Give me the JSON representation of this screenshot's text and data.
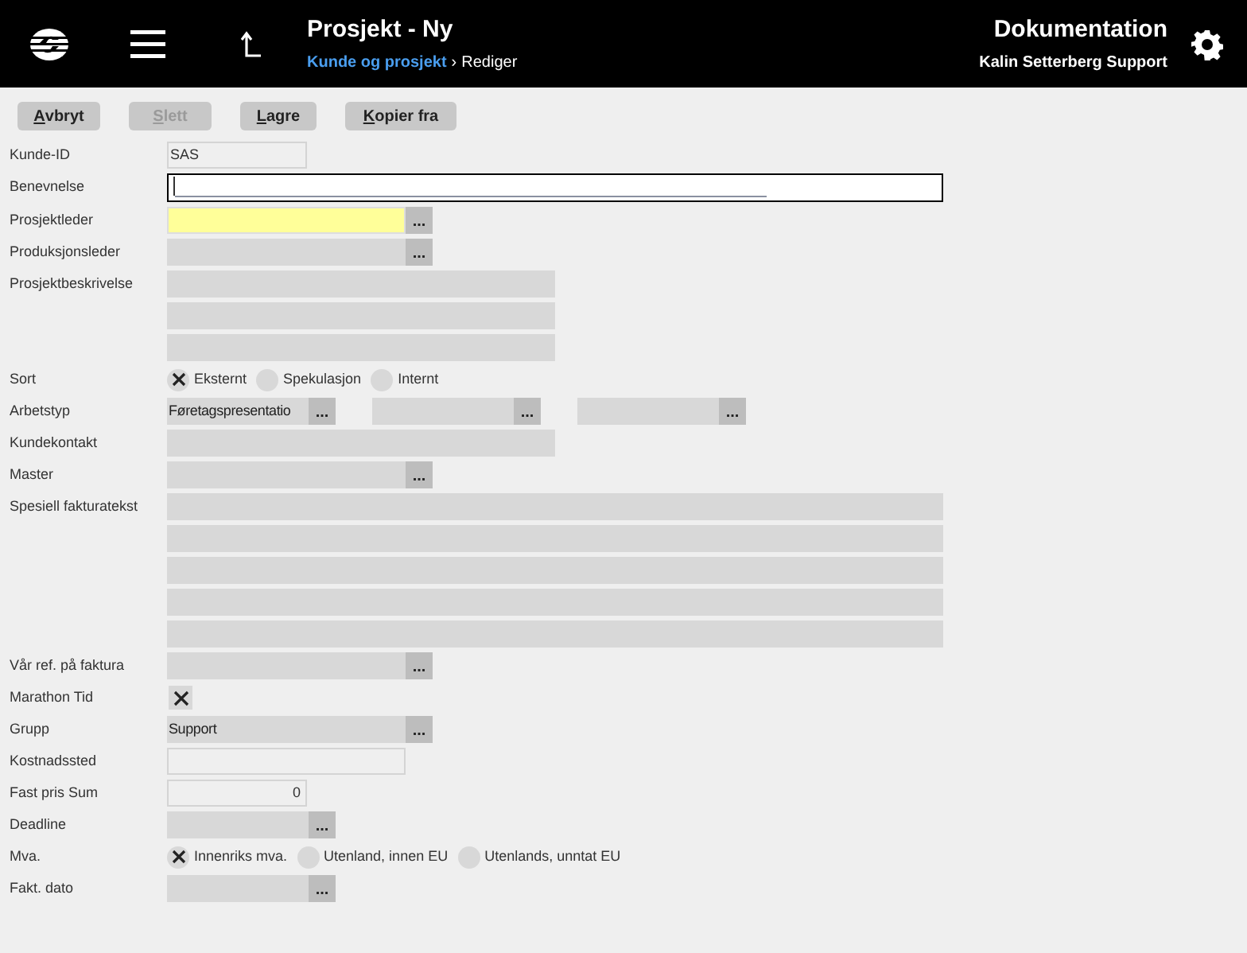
{
  "header": {
    "title": "Prosjekt - Ny",
    "breadcrumb_link": "Kunde og prosjekt",
    "breadcrumb_separator": "›",
    "breadcrumb_current": "Rediger",
    "app": "Dokumentation",
    "user": "Kalin Setterberg Support"
  },
  "toolbar": [
    {
      "label": "Avbryt",
      "disabled": false
    },
    {
      "label": "Slett",
      "disabled": true
    },
    {
      "label": "Lagre",
      "disabled": false
    },
    {
      "label": "Kopier fra",
      "disabled": false
    }
  ],
  "fields": [
    {
      "label": "Kunde-ID",
      "kind": "input",
      "value": "SAS"
    },
    {
      "label": "Benevnelse",
      "kind": "text",
      "focused": true
    },
    {
      "label": "Prosjektleder",
      "kind": "lookup",
      "required": true,
      "button": "..."
    },
    {
      "label": "Produksjonsleder",
      "kind": "lookup",
      "required": false,
      "button": "..."
    },
    {
      "label": "Prosjektbeskrivelse",
      "kind": "textarea"
    },
    {
      "label": "Sort",
      "kind": "radio",
      "options": [
        {
          "label": "Eksternt",
          "selected": true
        },
        {
          "label": "Spekulasjon",
          "selected": false
        },
        {
          "label": "Internt",
          "selected": false
        }
      ]
    },
    {
      "label": "Arbetstyp",
      "kind": "lookup_group",
      "items": [
        {
          "value": "Føretagspresentatio",
          "button": "..."
        },
        {
          "button": "..."
        },
        {
          "button": "..."
        }
      ]
    },
    {
      "label": "Kundekontakt",
      "kind": "textarea"
    },
    {
      "label": "Master",
      "kind": "lookup",
      "required": false,
      "button": "..."
    },
    {
      "label": "Spesiell fakturatekst",
      "kind": "textarea"
    },
    {
      "label": "Vår ref. på faktura",
      "kind": "lookup",
      "required": false,
      "button": "..."
    },
    {
      "label": "Marathon Tid",
      "kind": "checkbox",
      "checked": true
    },
    {
      "label": "Grupp",
      "kind": "lookup",
      "required": false,
      "value": "Support",
      "button": "..."
    },
    {
      "label": "Kostnadssted",
      "kind": "input"
    },
    {
      "label": "Fast pris Sum",
      "kind": "number",
      "value": "0"
    },
    {
      "label": "Deadline",
      "kind": "lookup",
      "required": false,
      "button": "..."
    },
    {
      "label": "Mva.",
      "kind": "radio",
      "options": [
        {
          "label": "Innenriks mva.",
          "selected": true
        },
        {
          "label": "Utenland, innen EU",
          "selected": false
        },
        {
          "label": "Utenlands, unntat EU",
          "selected": false
        }
      ]
    },
    {
      "label": "Fakt. dato",
      "kind": "lookup",
      "required": false,
      "button": "..."
    }
  ]
}
